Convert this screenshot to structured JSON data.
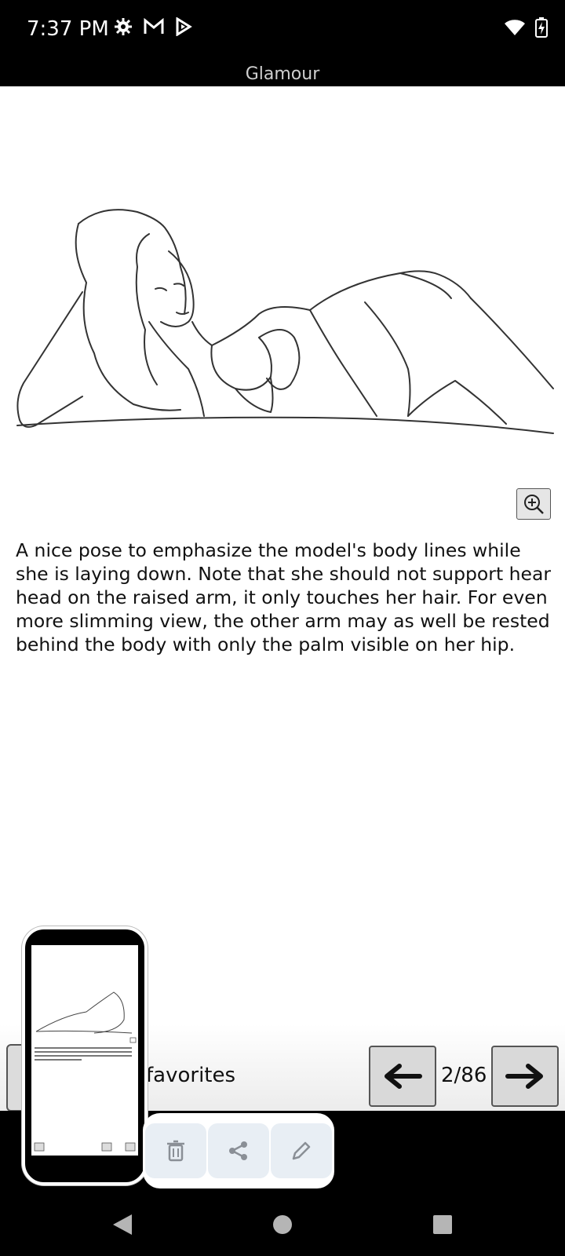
{
  "status_bar": {
    "time": "7:37 PM",
    "left_icons": [
      "gear-icon",
      "gmail-icon",
      "play-store-icon"
    ],
    "right_icons": [
      "wifi-icon",
      "battery-charging-icon"
    ]
  },
  "app": {
    "title": "Glamour"
  },
  "content": {
    "description": "A nice pose to emphasize the model's body lines while she is laying down. Note that she should not support hear head on the raised arm, it only touches her hair. For even more slimming view, the other arm may as well be rested behind the body with only the palm visible on her hip."
  },
  "bottom_bar": {
    "favorites_label": "favorites",
    "page_counter": "2/86",
    "prev_icon": "arrow-left-icon",
    "next_icon": "arrow-right-icon"
  },
  "screenshot_toolbar": {
    "actions": [
      "delete-icon",
      "share-icon",
      "edit-icon"
    ]
  },
  "system_nav": {
    "buttons": [
      "back-icon",
      "home-icon",
      "recents-icon"
    ]
  },
  "colors": {
    "bar_background": "#000000",
    "page_background": "#ffffff",
    "button_gray": "#d9d9d9",
    "toolbar_button": "#e8eef4"
  }
}
